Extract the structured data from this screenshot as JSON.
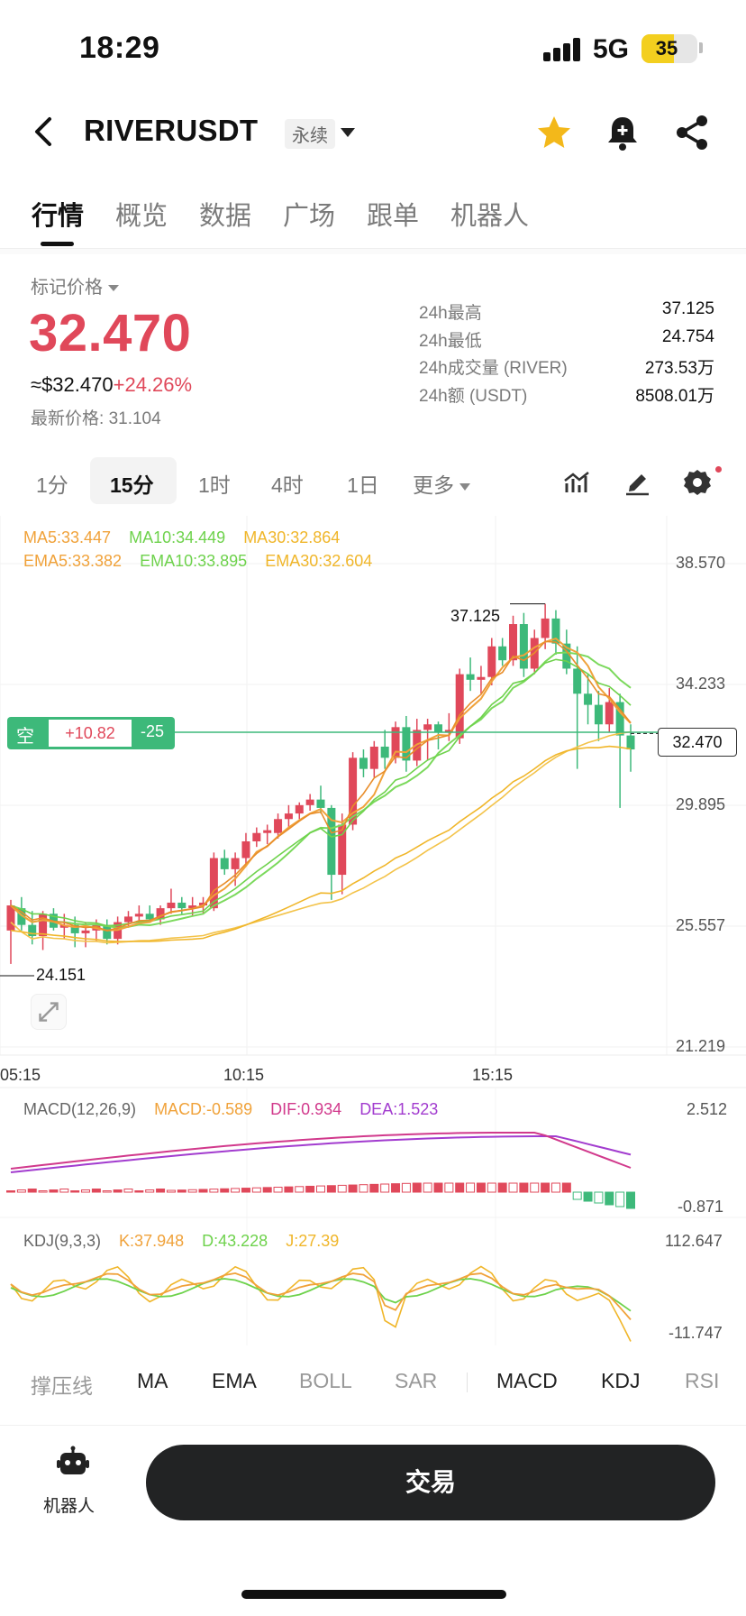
{
  "status_bar": {
    "time": "18:29",
    "network": "5G",
    "battery": "35"
  },
  "header": {
    "symbol": "RIVERUSDT",
    "contract_type": "永续"
  },
  "tabs": [
    {
      "label": "行情",
      "active": true
    },
    {
      "label": "概览"
    },
    {
      "label": "数据"
    },
    {
      "label": "广场"
    },
    {
      "label": "跟单"
    },
    {
      "label": "机器人"
    }
  ],
  "price_panel": {
    "mark_label": "标记价格",
    "mark_price": "32.470",
    "usd_price": "≈$32.470",
    "change_pct": "+24.26%",
    "last_price_label": "最新价格:",
    "last_price": "31.104"
  },
  "stats": [
    {
      "label": "24h最高",
      "value": "37.125"
    },
    {
      "label": "24h最低",
      "value": "24.754"
    },
    {
      "label": "24h成交量 (RIVER)",
      "value": "273.53万"
    },
    {
      "label": "24h额 (USDT)",
      "value": "8508.01万"
    }
  ],
  "intervals": [
    {
      "label": "1分"
    },
    {
      "label": "15分",
      "active": true
    },
    {
      "label": "1时"
    },
    {
      "label": "4时"
    },
    {
      "label": "1日"
    },
    {
      "label": "更多"
    }
  ],
  "ma_legend": {
    "ma5": "MA5:33.447",
    "ma10": "MA10:34.449",
    "ma30": "MA30:32.864",
    "ema5": "EMA5:33.382",
    "ema10": "EMA10:33.895",
    "ema30": "EMA30:32.604"
  },
  "chart_data": {
    "type": "candlestick",
    "interval": "15分",
    "price_axis_ticks": [
      "38.570",
      "34.233",
      "29.895",
      "25.557",
      "21.219"
    ],
    "time_axis_ticks": [
      "05:15",
      "10:15",
      "15:15"
    ],
    "current_price_label": "32.470",
    "high_marker": "37.125",
    "low_marker": "24.151",
    "candles": [
      {
        "o": 25.4,
        "h": 26.5,
        "l": 24.2,
        "c": 26.3
      },
      {
        "o": 26.2,
        "h": 26.6,
        "l": 25.4,
        "c": 25.6
      },
      {
        "o": 25.6,
        "h": 26.1,
        "l": 24.9,
        "c": 25.2
      },
      {
        "o": 25.2,
        "h": 26.1,
        "l": 24.7,
        "c": 26.0
      },
      {
        "o": 26.0,
        "h": 26.2,
        "l": 25.4,
        "c": 25.5
      },
      {
        "o": 25.5,
        "h": 26.0,
        "l": 25.1,
        "c": 25.6
      },
      {
        "o": 25.6,
        "h": 25.9,
        "l": 24.8,
        "c": 25.3
      },
      {
        "o": 25.3,
        "h": 25.7,
        "l": 24.8,
        "c": 25.4
      },
      {
        "o": 25.4,
        "h": 25.8,
        "l": 25.0,
        "c": 25.6
      },
      {
        "o": 25.6,
        "h": 25.8,
        "l": 24.9,
        "c": 25.1
      },
      {
        "o": 25.1,
        "h": 25.9,
        "l": 24.9,
        "c": 25.7
      },
      {
        "o": 25.7,
        "h": 26.1,
        "l": 25.5,
        "c": 25.9
      },
      {
        "o": 25.9,
        "h": 26.3,
        "l": 25.6,
        "c": 26.0
      },
      {
        "o": 26.0,
        "h": 26.3,
        "l": 25.7,
        "c": 25.8
      },
      {
        "o": 25.8,
        "h": 26.3,
        "l": 25.6,
        "c": 26.2
      },
      {
        "o": 26.2,
        "h": 26.9,
        "l": 26.0,
        "c": 26.4
      },
      {
        "o": 26.4,
        "h": 26.6,
        "l": 26.0,
        "c": 26.2
      },
      {
        "o": 26.2,
        "h": 26.6,
        "l": 25.9,
        "c": 26.3
      },
      {
        "o": 26.3,
        "h": 26.6,
        "l": 26.0,
        "c": 26.4
      },
      {
        "o": 26.2,
        "h": 28.2,
        "l": 26.1,
        "c": 28.0
      },
      {
        "o": 28.0,
        "h": 28.3,
        "l": 27.4,
        "c": 27.6
      },
      {
        "o": 27.6,
        "h": 28.2,
        "l": 27.0,
        "c": 28.0
      },
      {
        "o": 28.0,
        "h": 28.9,
        "l": 27.7,
        "c": 28.6
      },
      {
        "o": 28.6,
        "h": 29.1,
        "l": 28.4,
        "c": 28.9
      },
      {
        "o": 28.9,
        "h": 29.2,
        "l": 28.5,
        "c": 29.0
      },
      {
        "o": 28.9,
        "h": 29.6,
        "l": 28.7,
        "c": 29.4
      },
      {
        "o": 29.4,
        "h": 29.9,
        "l": 29.1,
        "c": 29.6
      },
      {
        "o": 29.6,
        "h": 30.0,
        "l": 29.4,
        "c": 29.9
      },
      {
        "o": 29.9,
        "h": 30.3,
        "l": 29.7,
        "c": 30.1
      },
      {
        "o": 30.1,
        "h": 30.6,
        "l": 29.6,
        "c": 29.8
      },
      {
        "o": 29.8,
        "h": 29.9,
        "l": 26.5,
        "c": 27.4
      },
      {
        "o": 27.4,
        "h": 29.6,
        "l": 26.7,
        "c": 29.2
      },
      {
        "o": 29.2,
        "h": 31.8,
        "l": 29.0,
        "c": 31.6
      },
      {
        "o": 31.6,
        "h": 31.9,
        "l": 30.9,
        "c": 31.2
      },
      {
        "o": 31.2,
        "h": 32.2,
        "l": 30.9,
        "c": 32.0
      },
      {
        "o": 32.0,
        "h": 32.6,
        "l": 31.2,
        "c": 31.6
      },
      {
        "o": 31.6,
        "h": 32.9,
        "l": 31.4,
        "c": 32.7
      },
      {
        "o": 32.7,
        "h": 33.1,
        "l": 31.1,
        "c": 31.5
      },
      {
        "o": 31.5,
        "h": 33.0,
        "l": 31.3,
        "c": 32.6
      },
      {
        "o": 32.6,
        "h": 33.0,
        "l": 31.5,
        "c": 32.8
      },
      {
        "o": 32.8,
        "h": 32.9,
        "l": 31.9,
        "c": 32.5
      },
      {
        "o": 32.5,
        "h": 33.2,
        "l": 32.2,
        "c": 32.6
      },
      {
        "o": 32.3,
        "h": 34.8,
        "l": 32.1,
        "c": 34.6
      },
      {
        "o": 34.6,
        "h": 35.2,
        "l": 34.0,
        "c": 34.4
      },
      {
        "o": 34.4,
        "h": 34.9,
        "l": 33.9,
        "c": 34.5
      },
      {
        "o": 34.5,
        "h": 35.9,
        "l": 34.2,
        "c": 35.6
      },
      {
        "o": 35.6,
        "h": 35.9,
        "l": 34.9,
        "c": 35.1
      },
      {
        "o": 35.1,
        "h": 36.7,
        "l": 34.9,
        "c": 36.4
      },
      {
        "o": 36.4,
        "h": 36.8,
        "l": 34.5,
        "c": 34.8
      },
      {
        "o": 34.8,
        "h": 36.2,
        "l": 34.6,
        "c": 35.9
      },
      {
        "o": 35.9,
        "h": 37.125,
        "l": 35.5,
        "c": 36.6
      },
      {
        "o": 36.6,
        "h": 36.9,
        "l": 35.3,
        "c": 35.7
      },
      {
        "o": 35.7,
        "h": 36.2,
        "l": 34.6,
        "c": 34.8
      },
      {
        "o": 34.8,
        "h": 35.6,
        "l": 31.2,
        "c": 33.9
      },
      {
        "o": 33.9,
        "h": 34.6,
        "l": 32.8,
        "c": 33.5
      },
      {
        "o": 33.5,
        "h": 34.0,
        "l": 32.2,
        "c": 32.8
      },
      {
        "o": 32.8,
        "h": 34.1,
        "l": 32.5,
        "c": 33.6
      },
      {
        "o": 33.6,
        "h": 33.9,
        "l": 29.8,
        "c": 32.4
      },
      {
        "o": 32.4,
        "h": 32.8,
        "l": 31.1,
        "c": 31.9
      }
    ]
  },
  "macd": {
    "title": "MACD(12,26,9)",
    "macd": "MACD:-0.589",
    "dif": "DIF:0.934",
    "dea": "DEA:1.523",
    "axis_top": "2.512",
    "axis_bottom": "-0.871"
  },
  "kdj": {
    "title": "KDJ(9,3,3)",
    "k": "K:37.948",
    "d": "D:43.228",
    "j": "J:27.39",
    "axis_top": "112.647",
    "axis_bottom": "-11.747"
  },
  "position_tag": {
    "side": "空",
    "pnl": "+10.82",
    "qty": "-25"
  },
  "indicator_bar": {
    "main": [
      "撑压线",
      "MA",
      "EMA",
      "BOLL",
      "SAR"
    ],
    "sub": [
      "MACD",
      "KDJ",
      "RSI"
    ]
  },
  "bottom": {
    "robot_label": "机器人",
    "trade_label": "交易"
  },
  "colors": {
    "up": "#e0485a",
    "down": "#3db97a",
    "ma5": "#f0a23a",
    "ma10": "#7bd95c",
    "ma30": "#f0c23a"
  }
}
